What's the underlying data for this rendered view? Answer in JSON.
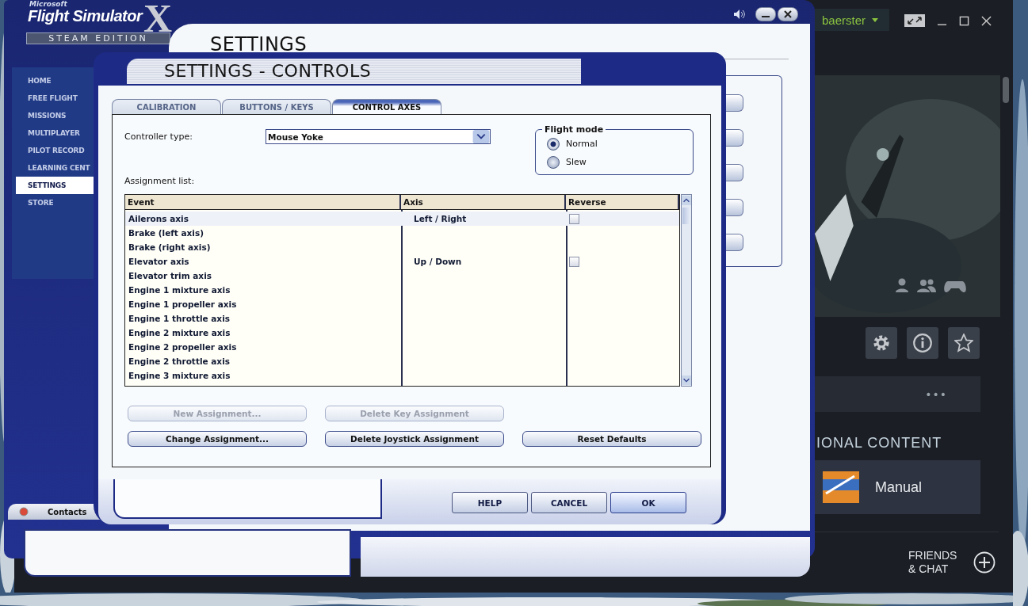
{
  "steam": {
    "user": "baerster",
    "more": "•••",
    "section_heading": "IONAL CONTENT",
    "dlc": {
      "label": "Manual"
    },
    "friends": "FRIENDS & CHAT"
  },
  "fsx": {
    "logo": {
      "maker": "Microsoft",
      "name": "Flight Simulator",
      "mark": "X",
      "edition": "STEAM EDITION"
    },
    "nav": [
      {
        "label": "HOME",
        "selected": false
      },
      {
        "label": "FREE FLIGHT",
        "selected": false
      },
      {
        "label": "MISSIONS",
        "selected": false
      },
      {
        "label": "MULTIPLAYER",
        "selected": false
      },
      {
        "label": "PILOT RECORD",
        "selected": false
      },
      {
        "label": "LEARNING CENT",
        "selected": false
      },
      {
        "label": "SETTINGS",
        "selected": true
      },
      {
        "label": "STORE",
        "selected": false
      }
    ],
    "title": "SETTINGS",
    "contacts": "Contacts"
  },
  "dialog": {
    "title": "SETTINGS - CONTROLS",
    "tabs": [
      {
        "label": "CALIBRATION",
        "selected": false
      },
      {
        "label": "BUTTONS / KEYS",
        "selected": false
      },
      {
        "label": "CONTROL AXES",
        "selected": true
      }
    ],
    "controller_type": {
      "label": "Controller type:",
      "value": "Mouse Yoke"
    },
    "flight_mode": {
      "title": "Flight mode",
      "options": [
        {
          "label": "Normal",
          "selected": true
        },
        {
          "label": "Slew",
          "selected": false
        }
      ]
    },
    "assignment_label": "Assignment list:",
    "table": {
      "columns": [
        "Event",
        "Axis",
        "Reverse"
      ],
      "rows": [
        {
          "event": "Ailerons axis",
          "axis": "Left / Right",
          "reverse": false,
          "selected": true
        },
        {
          "event": "Brake (left axis)",
          "selected": false
        },
        {
          "event": "Brake (right axis)",
          "selected": false
        },
        {
          "event": "Elevator axis",
          "axis": "Up / Down",
          "reverse": false,
          "selected": false
        },
        {
          "event": "Elevator trim axis",
          "selected": false
        },
        {
          "event": "Engine 1 mixture axis",
          "selected": false
        },
        {
          "event": "Engine 1 propeller axis",
          "selected": false
        },
        {
          "event": "Engine 1 throttle axis",
          "selected": false
        },
        {
          "event": "Engine 2 mixture axis",
          "selected": false
        },
        {
          "event": "Engine 2 propeller axis",
          "selected": false
        },
        {
          "event": "Engine 2 throttle axis",
          "selected": false
        },
        {
          "event": "Engine 3 mixture axis",
          "selected": false
        }
      ]
    },
    "buttons": [
      {
        "label": "New Assignment...",
        "disabled": true
      },
      {
        "label": "Delete Key Assignment",
        "disabled": true
      },
      {
        "label": "Change Assignment...",
        "disabled": false
      },
      {
        "label": "Delete Joystick Assignment",
        "disabled": false
      },
      {
        "label": "Reset Defaults",
        "disabled": false
      }
    ],
    "footer_buttons": [
      {
        "label": "HELP",
        "kind": "normal"
      },
      {
        "label": "CANCEL",
        "kind": "normal"
      },
      {
        "label": "OK",
        "kind": "default"
      }
    ]
  }
}
